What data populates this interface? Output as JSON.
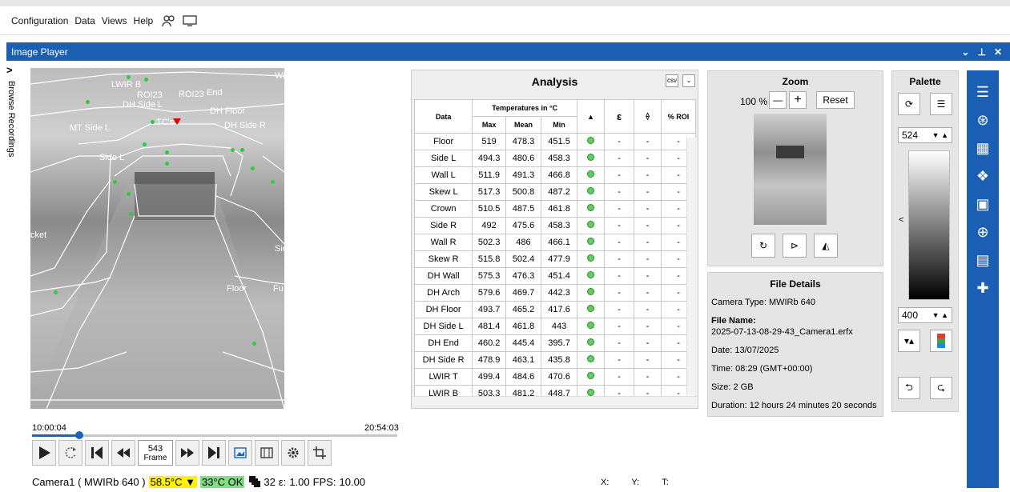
{
  "menu": {
    "items": [
      "Configuration",
      "Data",
      "Views",
      "Help"
    ]
  },
  "panel": {
    "title": "Image Player",
    "controls": [
      "⌄",
      "⊥",
      "✕"
    ]
  },
  "sidetab": {
    "arrow": ">",
    "label": "Browse Recordings"
  },
  "thermal": {
    "labels": [
      {
        "text": "LWIR B"
      },
      {
        "text": "ROI23"
      },
      {
        "text": "DH Side L"
      },
      {
        "text": "ROI23"
      },
      {
        "text": "End"
      },
      {
        "text": "DH Floor"
      },
      {
        "text": "DH Side R"
      },
      {
        "text": "MT Side L"
      },
      {
        "text": "TC's"
      },
      {
        "text": "Side L"
      },
      {
        "text": "cket"
      },
      {
        "text": "Floor"
      },
      {
        "text": "Fu"
      },
      {
        "text": "Wi"
      },
      {
        "text": "Sid"
      }
    ]
  },
  "player": {
    "time_start": "10:00:04",
    "time_end": "20:54:03",
    "progress": 0.13,
    "frame_value": "543",
    "frame_label": "Frame",
    "camera": "Camera1 ( MWIRb 640 )",
    "temp_high": "58.5°C",
    "temp_ok": "33°C OK",
    "value_32": "32",
    "epsilon_label": "ε:",
    "epsilon_value": "1.00",
    "fps_label": "FPS:",
    "fps_value": "10.00"
  },
  "coords": {
    "x": "X:",
    "y": "Y:",
    "t": "T:"
  },
  "analysis": {
    "title": "Analysis",
    "headers": {
      "data": "Data",
      "temps": "Temperatures in °C",
      "max": "Max",
      "mean": "Mean",
      "min": "Min",
      "eps": "ε",
      "roi": "% ROI"
    },
    "rows": [
      {
        "name": "Floor",
        "max": "519",
        "mean": "478.3",
        "min": "451.5"
      },
      {
        "name": "Side L",
        "max": "494.3",
        "mean": "480.6",
        "min": "458.3"
      },
      {
        "name": "Wall L",
        "max": "511.9",
        "mean": "491.3",
        "min": "466.8"
      },
      {
        "name": "Skew L",
        "max": "517.3",
        "mean": "500.8",
        "min": "487.2"
      },
      {
        "name": "Crown",
        "max": "510.5",
        "mean": "487.5",
        "min": "461.8"
      },
      {
        "name": "Side R",
        "max": "492",
        "mean": "475.6",
        "min": "458.3"
      },
      {
        "name": "Wall R",
        "max": "502.3",
        "mean": "486",
        "min": "466.1"
      },
      {
        "name": "Skew R",
        "max": "515.8",
        "mean": "502.4",
        "min": "477.9"
      },
      {
        "name": "DH Wall",
        "max": "575.3",
        "mean": "476.3",
        "min": "451.4"
      },
      {
        "name": "DH Arch",
        "max": "579.6",
        "mean": "469.7",
        "min": "442.3"
      },
      {
        "name": "DH Floor",
        "max": "493.7",
        "mean": "465.2",
        "min": "417.6"
      },
      {
        "name": "DH Side L",
        "max": "481.4",
        "mean": "461.8",
        "min": "443"
      },
      {
        "name": "DH End",
        "max": "460.2",
        "mean": "445.4",
        "min": "395.7"
      },
      {
        "name": "DH Side R",
        "max": "478.9",
        "mean": "463.1",
        "min": "435.8"
      },
      {
        "name": "LWIR T",
        "max": "499.4",
        "mean": "484.6",
        "min": "470.6"
      },
      {
        "name": "LWIR B",
        "max": "503.3",
        "mean": "481.2",
        "min": "448.7"
      }
    ],
    "dash": "-"
  },
  "zoom": {
    "title": "Zoom",
    "percent": "100 %",
    "minus": "—",
    "plus": "+",
    "reset": "Reset"
  },
  "file": {
    "title": "File Details",
    "camera_type": "Camera Type: MWIRb 640",
    "file_name_label": "File Name:",
    "file_name": "2025-07-13-08-29-43_Camera1.erfx",
    "date": "Date: 13/07/2025",
    "time": "Time: 08:29 (GMT+00:00)",
    "size": "Size: 2 GB",
    "duration": "Duration: 12 hours 24 minutes 20 seconds"
  },
  "palette": {
    "title": "Palette",
    "top_value": "524",
    "bottom_value": "400",
    "collapse": "<"
  }
}
